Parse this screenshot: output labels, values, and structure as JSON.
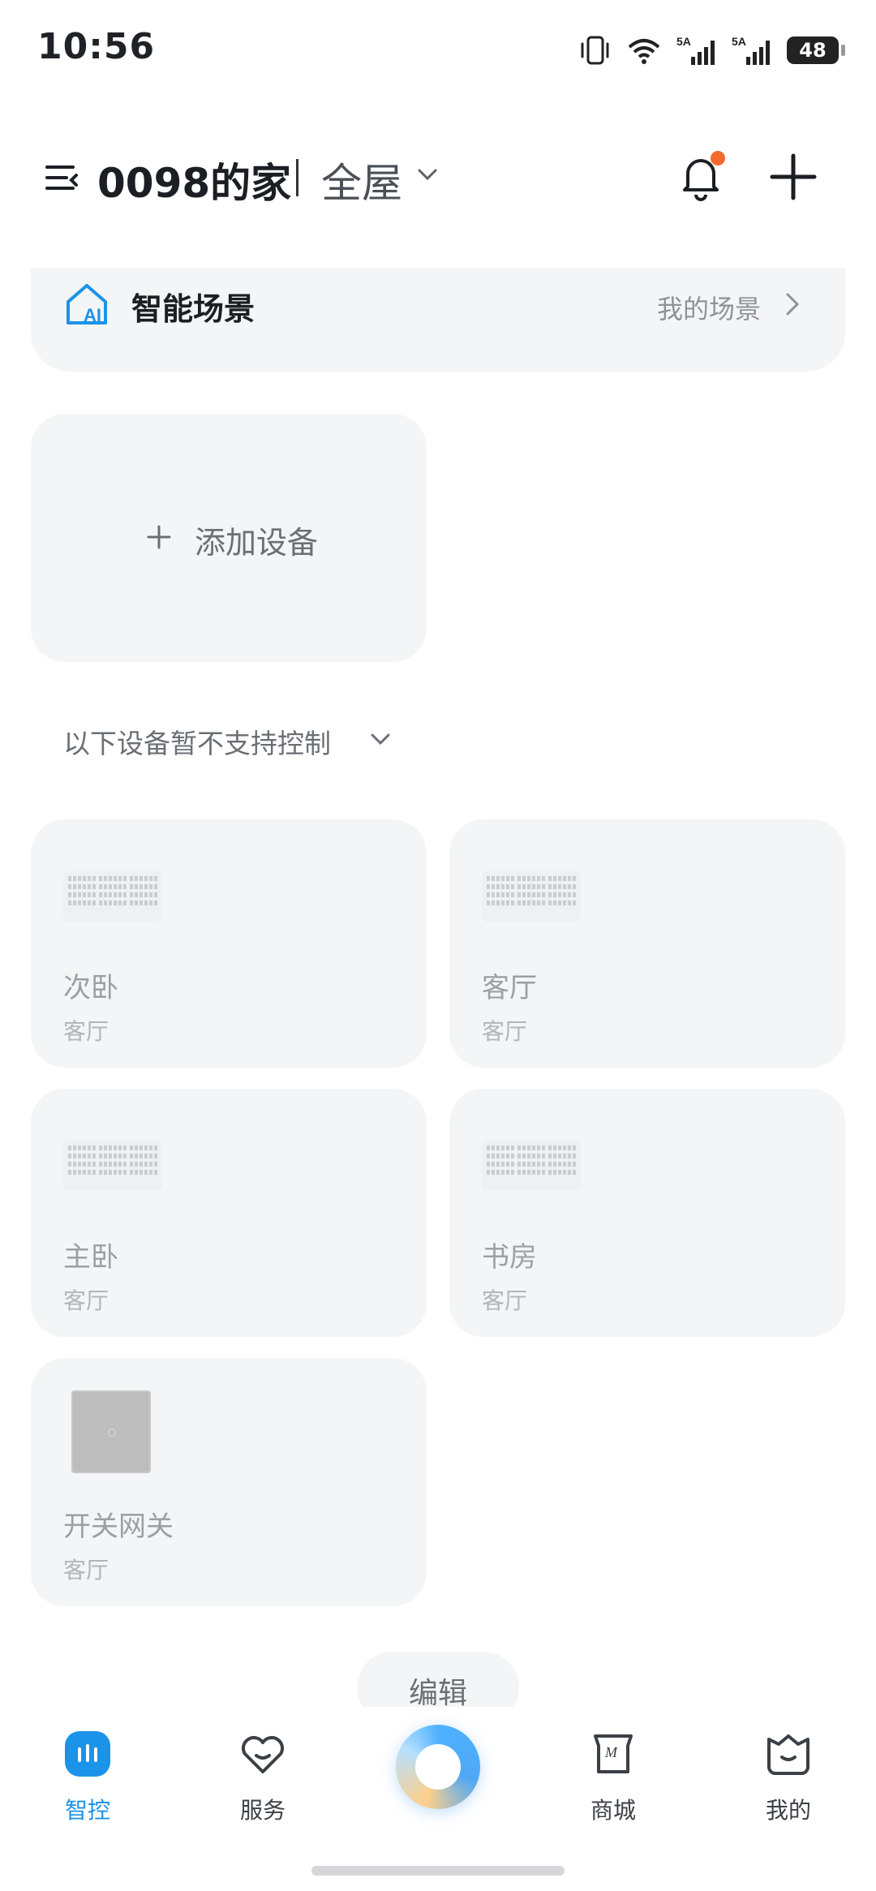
{
  "status_bar": {
    "time": "10:56",
    "battery": "48",
    "network_1": "5A",
    "network_2": "5A",
    "wifi_label": "6"
  },
  "header": {
    "home_name": "0098的家",
    "room_selector": "全屋"
  },
  "scene": {
    "title": "智能场景",
    "link": "我的场景"
  },
  "add_device": {
    "label": "添加设备"
  },
  "unsupported": {
    "label": "以下设备暂不支持控制"
  },
  "devices": [
    {
      "name": "次卧",
      "room": "客厅",
      "icon": "panel-icon"
    },
    {
      "name": "客厅",
      "room": "客厅",
      "icon": "panel-icon"
    },
    {
      "name": "主卧",
      "room": "客厅",
      "icon": "panel-icon"
    },
    {
      "name": "书房",
      "room": "客厅",
      "icon": "panel-icon"
    },
    {
      "name": "开关网关",
      "room": "客厅",
      "icon": "gateway-icon"
    }
  ],
  "edit": {
    "label": "编辑"
  },
  "bottom_nav": {
    "items": [
      {
        "label": "智控",
        "active": true
      },
      {
        "label": "服务",
        "active": false
      },
      {
        "label": "商城",
        "active": false
      },
      {
        "label": "我的",
        "active": false
      }
    ]
  },
  "colors": {
    "accent": "#1a93e8",
    "card_bg": "#f4f5f7",
    "notification_dot": "#f46a2e"
  }
}
